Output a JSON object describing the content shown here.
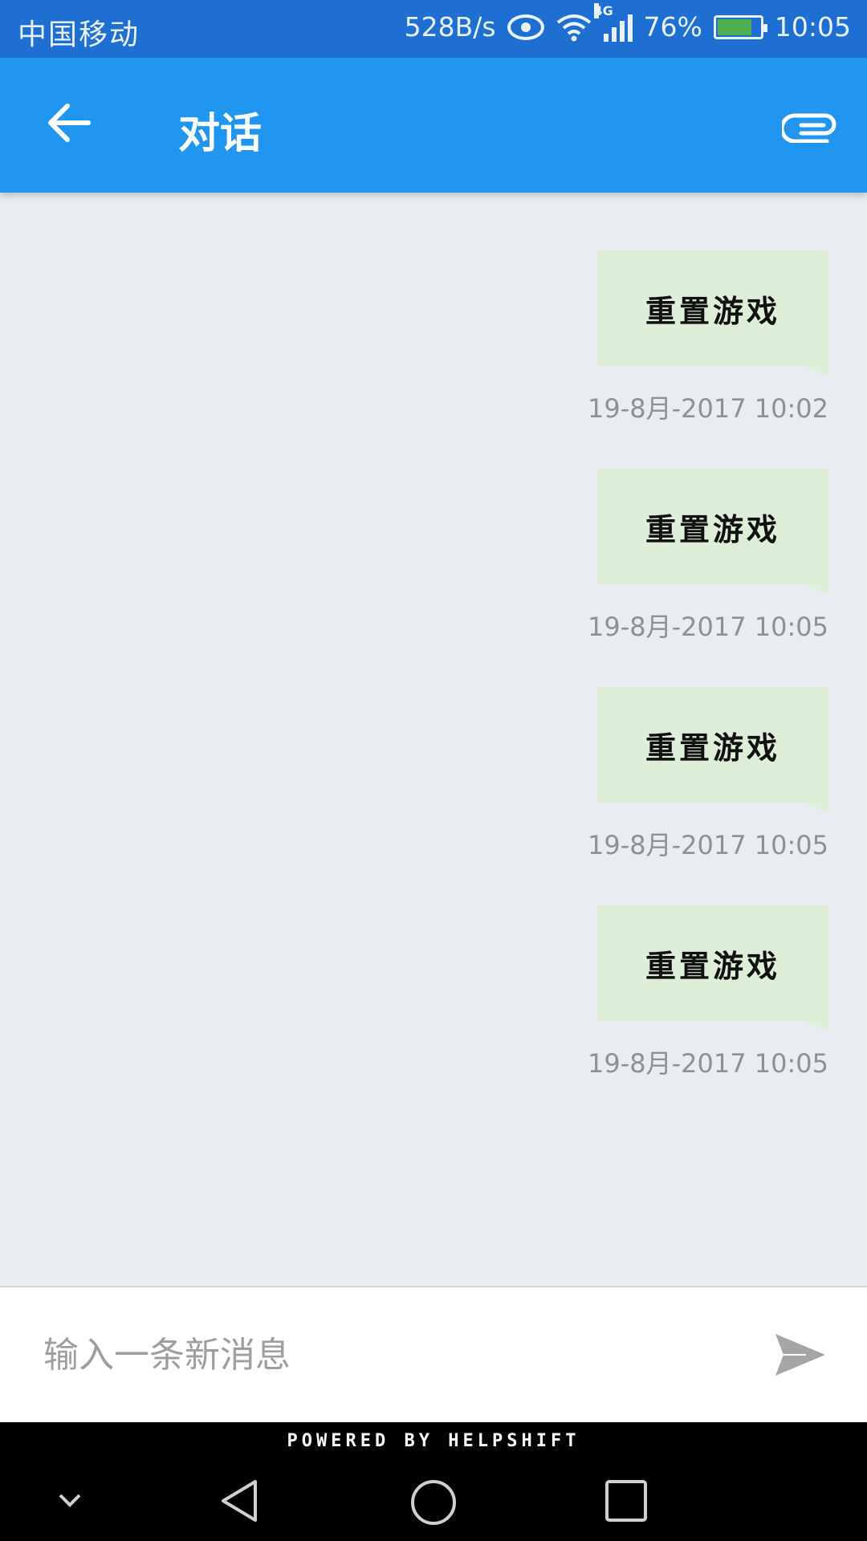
{
  "status_bar": {
    "carrier": "中国移动",
    "net_speed": "528B/s",
    "network_type": "4G",
    "battery": "76%",
    "time": "10:05"
  },
  "header": {
    "title": "对话",
    "back_icon": "arrow-left-icon",
    "attach_icon": "paperclip-icon"
  },
  "messages": [
    {
      "text": "重置游戏",
      "timestamp": "19-8月-2017 10:02"
    },
    {
      "text": "重置游戏",
      "timestamp": "19-8月-2017 10:05"
    },
    {
      "text": "重置游戏",
      "timestamp": "19-8月-2017 10:05"
    },
    {
      "text": "重置游戏",
      "timestamp": "19-8月-2017 10:05"
    }
  ],
  "composer": {
    "placeholder": "输入一条新消息",
    "value": "",
    "send_icon": "send-icon"
  },
  "footer": {
    "powered_by": "POWERED BY HELPSHIFT"
  },
  "colors": {
    "status_bar": "#1E6FD1",
    "app_bar": "#2196F0",
    "background": "#E9EDF1",
    "bubble": "#DDEFD8",
    "timestamp": "#8C9196"
  }
}
